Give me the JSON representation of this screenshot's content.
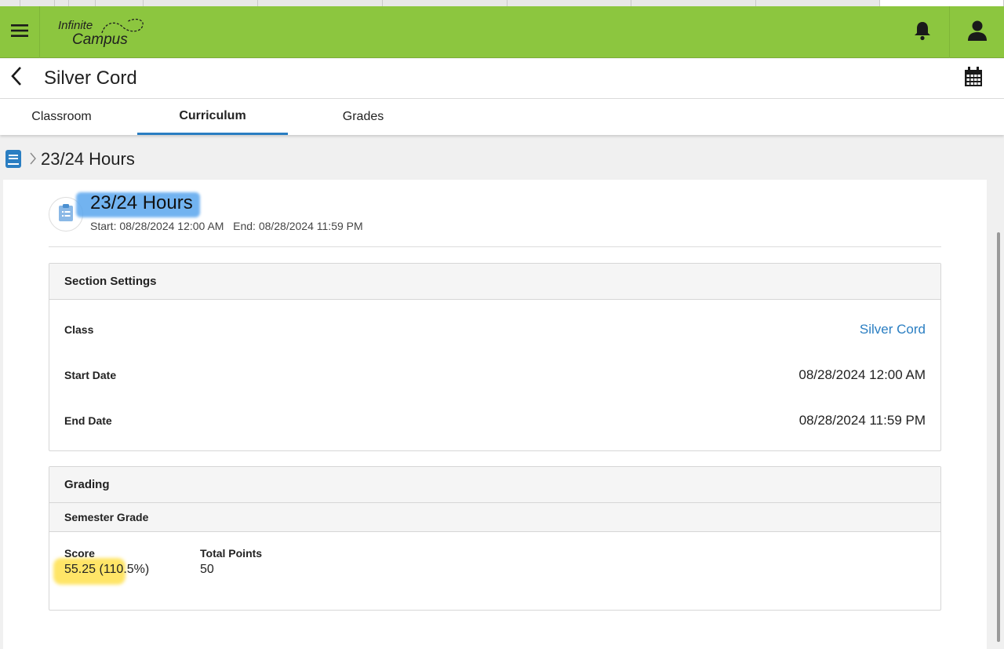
{
  "app": {
    "logo_line1": "Infinite",
    "logo_line2": "Campus",
    "brand_color": "#8cc63f",
    "accent_color": "#2a7ec2"
  },
  "header": {
    "menu_icon": "hamburger-menu-icon",
    "notifications_icon": "bell-icon",
    "user_icon": "user-icon"
  },
  "titlebar": {
    "back_icon": "chevron-left-icon",
    "title": "Silver Cord",
    "calendar_icon": "calendar-icon"
  },
  "tabs": [
    {
      "label": "Classroom",
      "active": false
    },
    {
      "label": "Curriculum",
      "active": true
    },
    {
      "label": "Grades",
      "active": false
    }
  ],
  "breadcrumb": {
    "icon": "book-icon",
    "text": "23/24 Hours"
  },
  "assignment": {
    "icon": "clipboard-icon",
    "title": "23/24 Hours",
    "dates": "Start: 08/28/2024 12:00 AM   End: 08/28/2024 11:59 PM"
  },
  "section_settings": {
    "heading": "Section Settings",
    "rows": [
      {
        "label": "Class",
        "value": "Silver Cord"
      },
      {
        "label": "Start Date",
        "value": "08/28/2024 12:00 AM"
      },
      {
        "label": "End Date",
        "value": "08/28/2024 11:59 PM"
      }
    ]
  },
  "grading": {
    "heading": "Grading",
    "subheading": "Semester Grade",
    "score_label": "Score",
    "score_value": "55.25 (110.5%)",
    "total_points_label": "Total Points",
    "total_points_value": "50"
  }
}
